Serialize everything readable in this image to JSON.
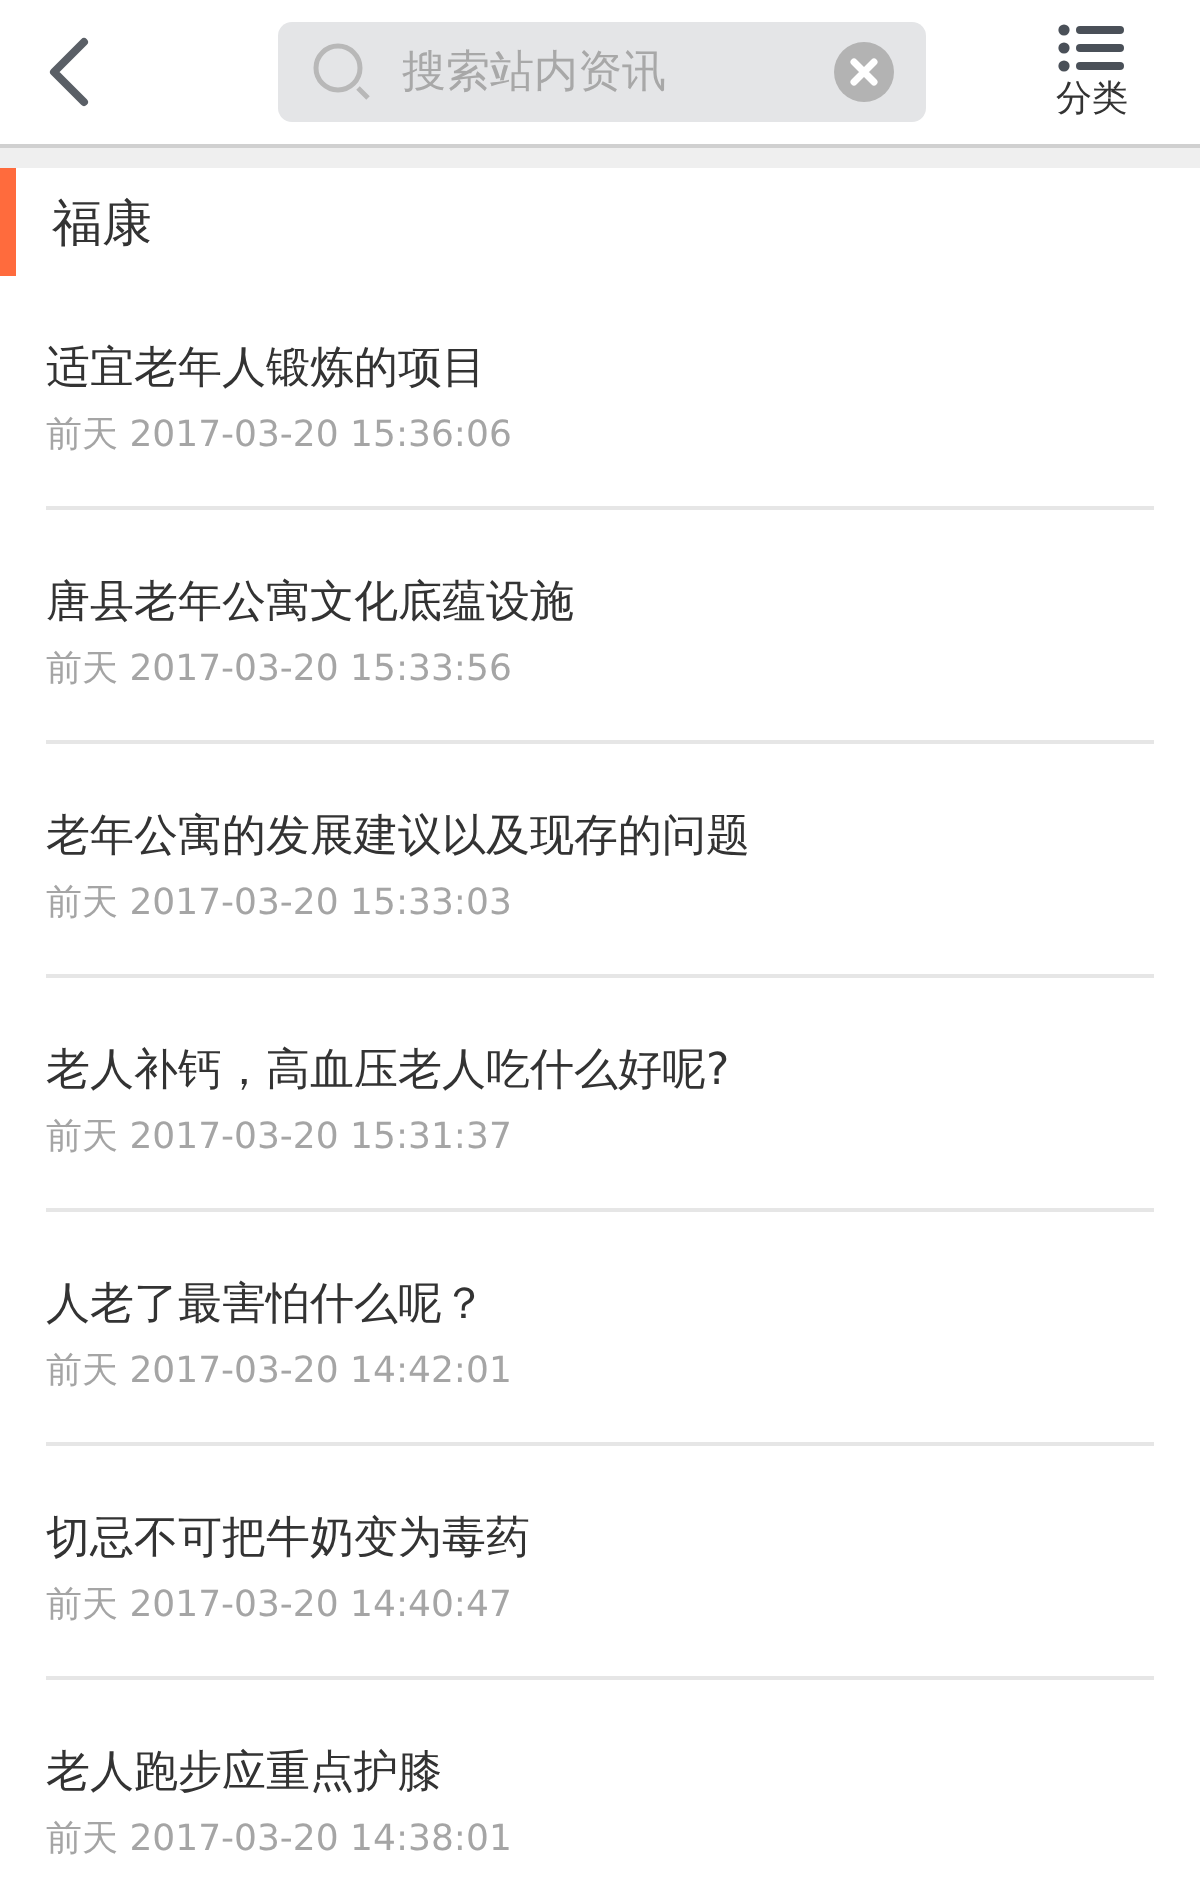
{
  "header": {
    "search": {
      "placeholder": "搜索站内资讯"
    },
    "category_label": "分类"
  },
  "section_title": "福康",
  "articles": [
    {
      "title": "适宜老年人锻炼的项目",
      "time": "前天 2017-03-20 15:36:06"
    },
    {
      "title": "唐县老年公寓文化底蕴设施",
      "time": "前天 2017-03-20 15:33:56"
    },
    {
      "title": "老年公寓的发展建议以及现存的问题",
      "time": "前天 2017-03-20 15:33:03"
    },
    {
      "title": "老人补钙，高血压老人吃什么好呢?",
      "time": "前天 2017-03-20 15:31:37"
    },
    {
      "title": "人老了最害怕什么呢？",
      "time": "前天 2017-03-20 14:42:01"
    },
    {
      "title": "切忌不可把牛奶变为毒药",
      "time": "前天 2017-03-20 14:40:47"
    },
    {
      "title": "老人跑步应重点护膝",
      "time": "前天 2017-03-20 14:38:01"
    }
  ]
}
